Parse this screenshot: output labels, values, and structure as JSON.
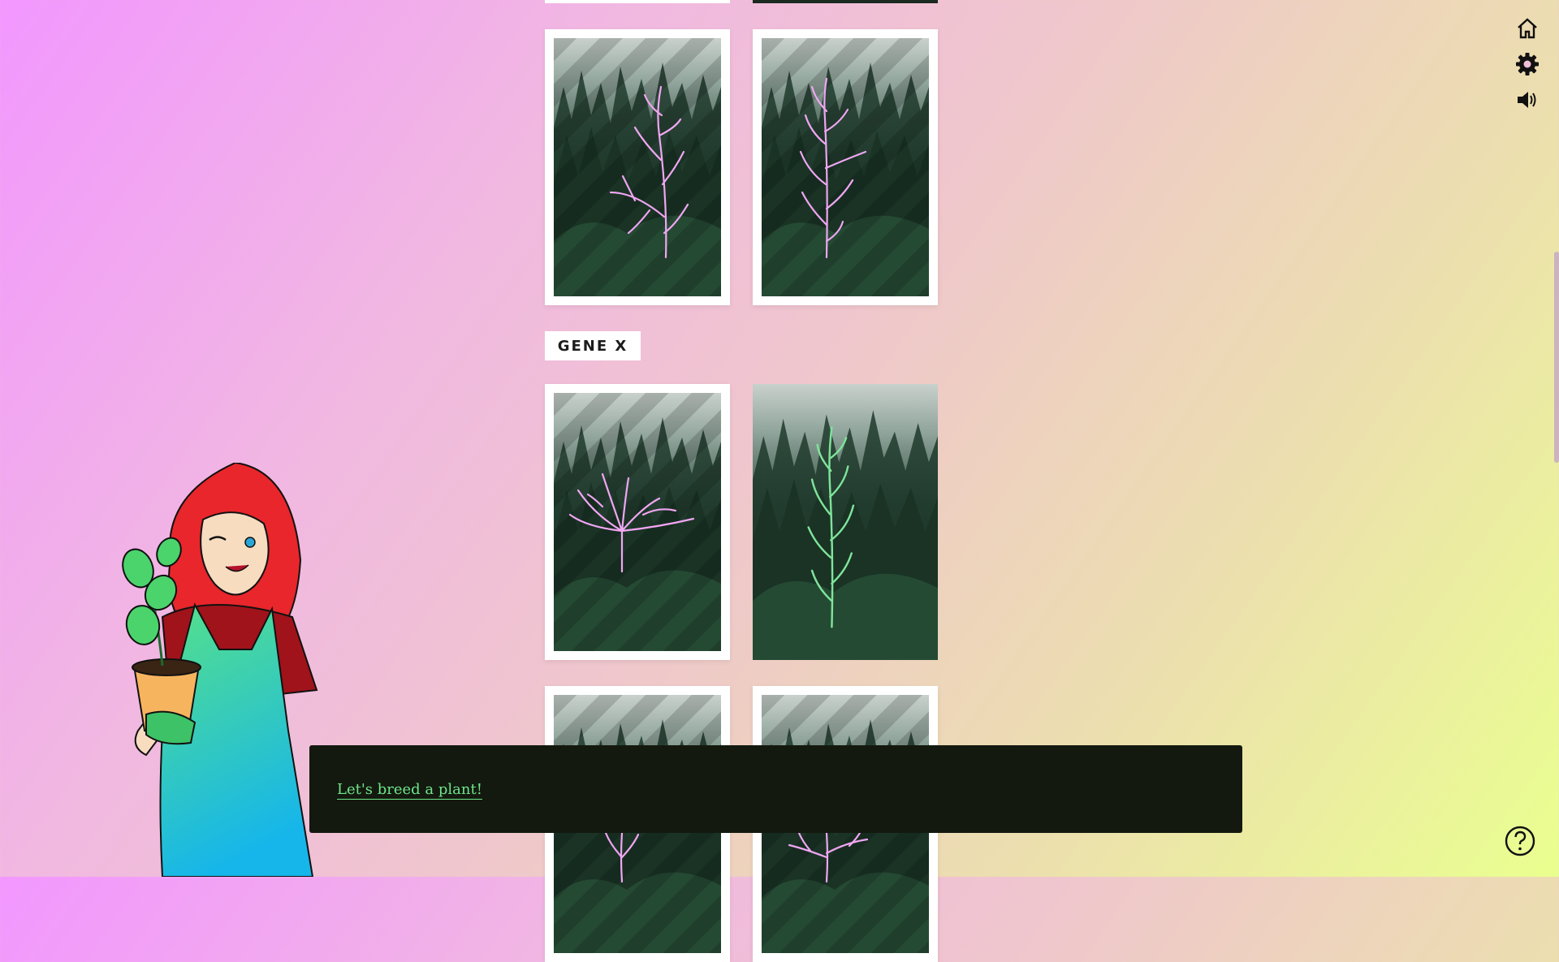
{
  "section_label": "GENE X",
  "dialog": {
    "text": "Let's breed a plant!"
  },
  "icons": {
    "home": "home-icon",
    "settings": "gear-icon",
    "sound": "speaker-icon",
    "help": "help-icon"
  },
  "colors": {
    "plant_pink": "#f0a6f2",
    "plant_green": "#7fe49a",
    "dialog_bg": "#13190f",
    "link": "#6ee58a"
  }
}
